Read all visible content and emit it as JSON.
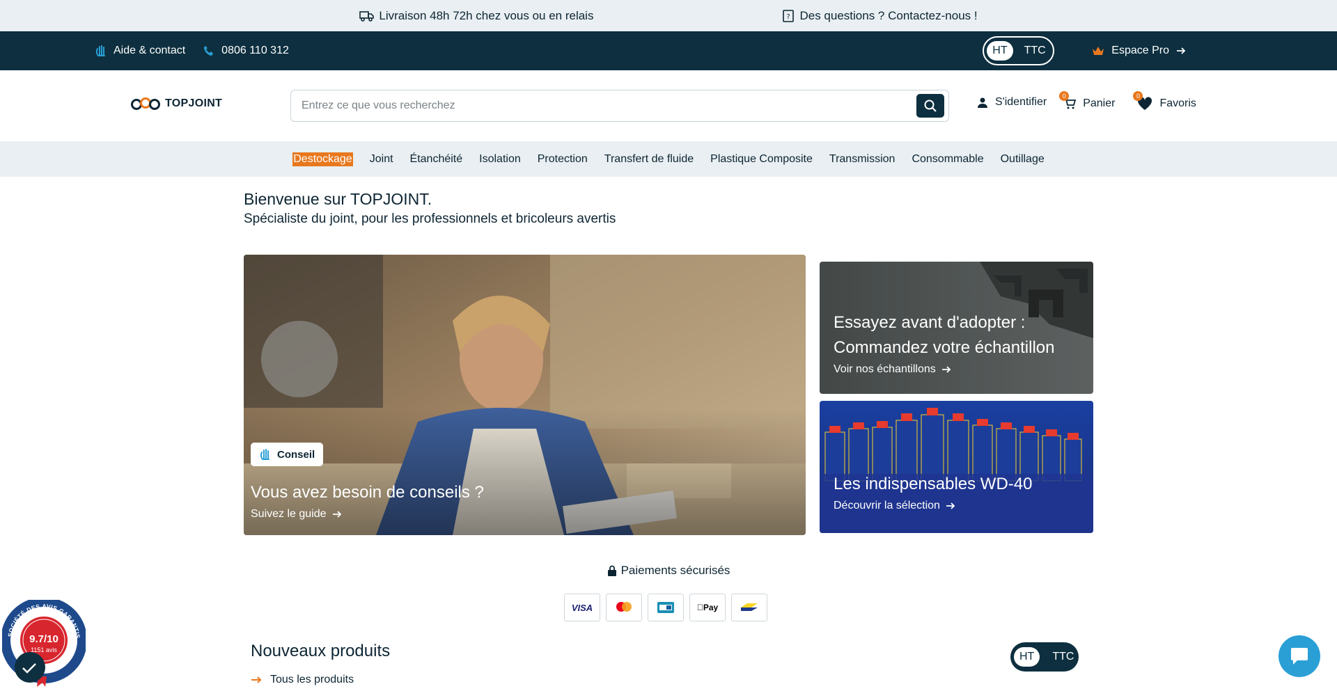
{
  "topbar": {
    "delivery": "Livraison 48h 72h chez vous ou en relais",
    "questions": "Des questions ? Contactez-nous !"
  },
  "darkbar": {
    "help": "Aide & contact",
    "phone": "0806 110 312",
    "tax_ht": "HT",
    "tax_ttc": "TTC",
    "espace_pro": "Espace Pro"
  },
  "header": {
    "logo_text": "TOPJOINT",
    "search_placeholder": "Entrez ce que vous recherchez",
    "login": "S'identifier",
    "cart": "Panier",
    "cart_count": "0",
    "favorites": "Favoris",
    "favorites_count": "0"
  },
  "categories": [
    "Destockage",
    "Joint",
    "Étanchéité",
    "Isolation",
    "Protection",
    "Transfert de fluide",
    "Plastique Composite",
    "Transmission",
    "Consommable",
    "Outillage"
  ],
  "welcome": {
    "title": "Bienvenue sur TOPJOINT.",
    "subtitle": "Spécialiste du joint, pour les professionnels et bricoleurs avertis"
  },
  "hero": {
    "main_badge": "Conseil",
    "main_title": "Vous avez besoin de conseils ?",
    "main_link": "Suivez le guide",
    "side1_title_1": "Essayez avant d'adopter :",
    "side1_title_2": "Commandez votre échantillon",
    "side1_link": "Voir nos échantillons",
    "side2_title": "Les indispensables WD-40",
    "side2_link": "Découvrir la sélection"
  },
  "payments": {
    "title": "Paiements sécurisés",
    "cards": [
      "VISA",
      "mastercard",
      "CB",
      "Pay",
      "bancontact"
    ]
  },
  "new_products": {
    "title": "Nouveaux produits",
    "all_link": "Tous les produits",
    "tax_ht": "HT",
    "tax_ttc": "TTC"
  },
  "seal": {
    "score": "9.7/10",
    "reviews": "1151 avis",
    "ring_text": "SOCIÉTÉ DES AVIS GARANTIS"
  },
  "colors": {
    "primary": "#0d2f3f",
    "accent": "#e8781e",
    "light_bg": "#e9eff2",
    "chat": "#2a9fd6"
  }
}
